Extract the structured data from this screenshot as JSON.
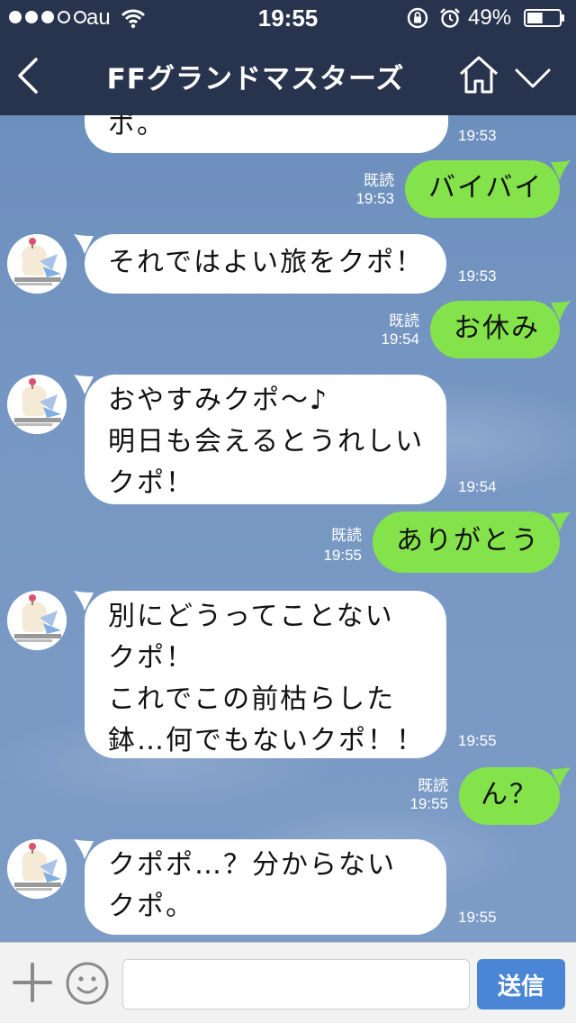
{
  "status_bar": {
    "carrier": "au",
    "time": "19:55",
    "battery_pct": "49%",
    "signal_bars_filled": 3,
    "signal_bars_total": 5,
    "battery_level": 0.49
  },
  "header": {
    "title": "FFグランドマスターズ",
    "icons": [
      "back-chevron-icon",
      "home-icon",
      "chevron-down-icon"
    ]
  },
  "messages": [
    {
      "id": "m1",
      "side": "in",
      "text": "ポ。",
      "time": "19:53"
    },
    {
      "id": "m2",
      "side": "out",
      "text": "バイバイ",
      "read": "既読",
      "time": "19:53"
    },
    {
      "id": "m3",
      "side": "in",
      "text": "それではよい旅をクポ！",
      "time": "19:53"
    },
    {
      "id": "m4",
      "side": "out",
      "text": "お休み",
      "read": "既読",
      "time": "19:54"
    },
    {
      "id": "m5",
      "side": "in",
      "text": "おやすみクポ〜♪\n明日も会えるとうれしい\nクポ！",
      "time": "19:54"
    },
    {
      "id": "m6",
      "side": "out",
      "text": "ありがとう",
      "read": "既読",
      "time": "19:55"
    },
    {
      "id": "m7",
      "side": "in",
      "text": "別にどうってことない\nクポ！\nこれでこの前枯らした\n鉢…何でもないクポ！！",
      "time": "19:55"
    },
    {
      "id": "m8",
      "side": "out",
      "text": "ん？",
      "read": "既読",
      "time": "19:55"
    },
    {
      "id": "m9",
      "side": "in",
      "text": "クポポ…？分からない\nクポ。",
      "time": "19:55"
    }
  ],
  "input_bar": {
    "placeholder": "",
    "send_label": "送信",
    "icons": [
      "plus-icon",
      "emoji-icon"
    ]
  },
  "colors": {
    "header_bg": "#28344d",
    "outgoing_bubble": "#84e34b",
    "incoming_bubble": "#ffffff",
    "chat_bg": "#7898c4",
    "send_button": "#4b86d6"
  }
}
